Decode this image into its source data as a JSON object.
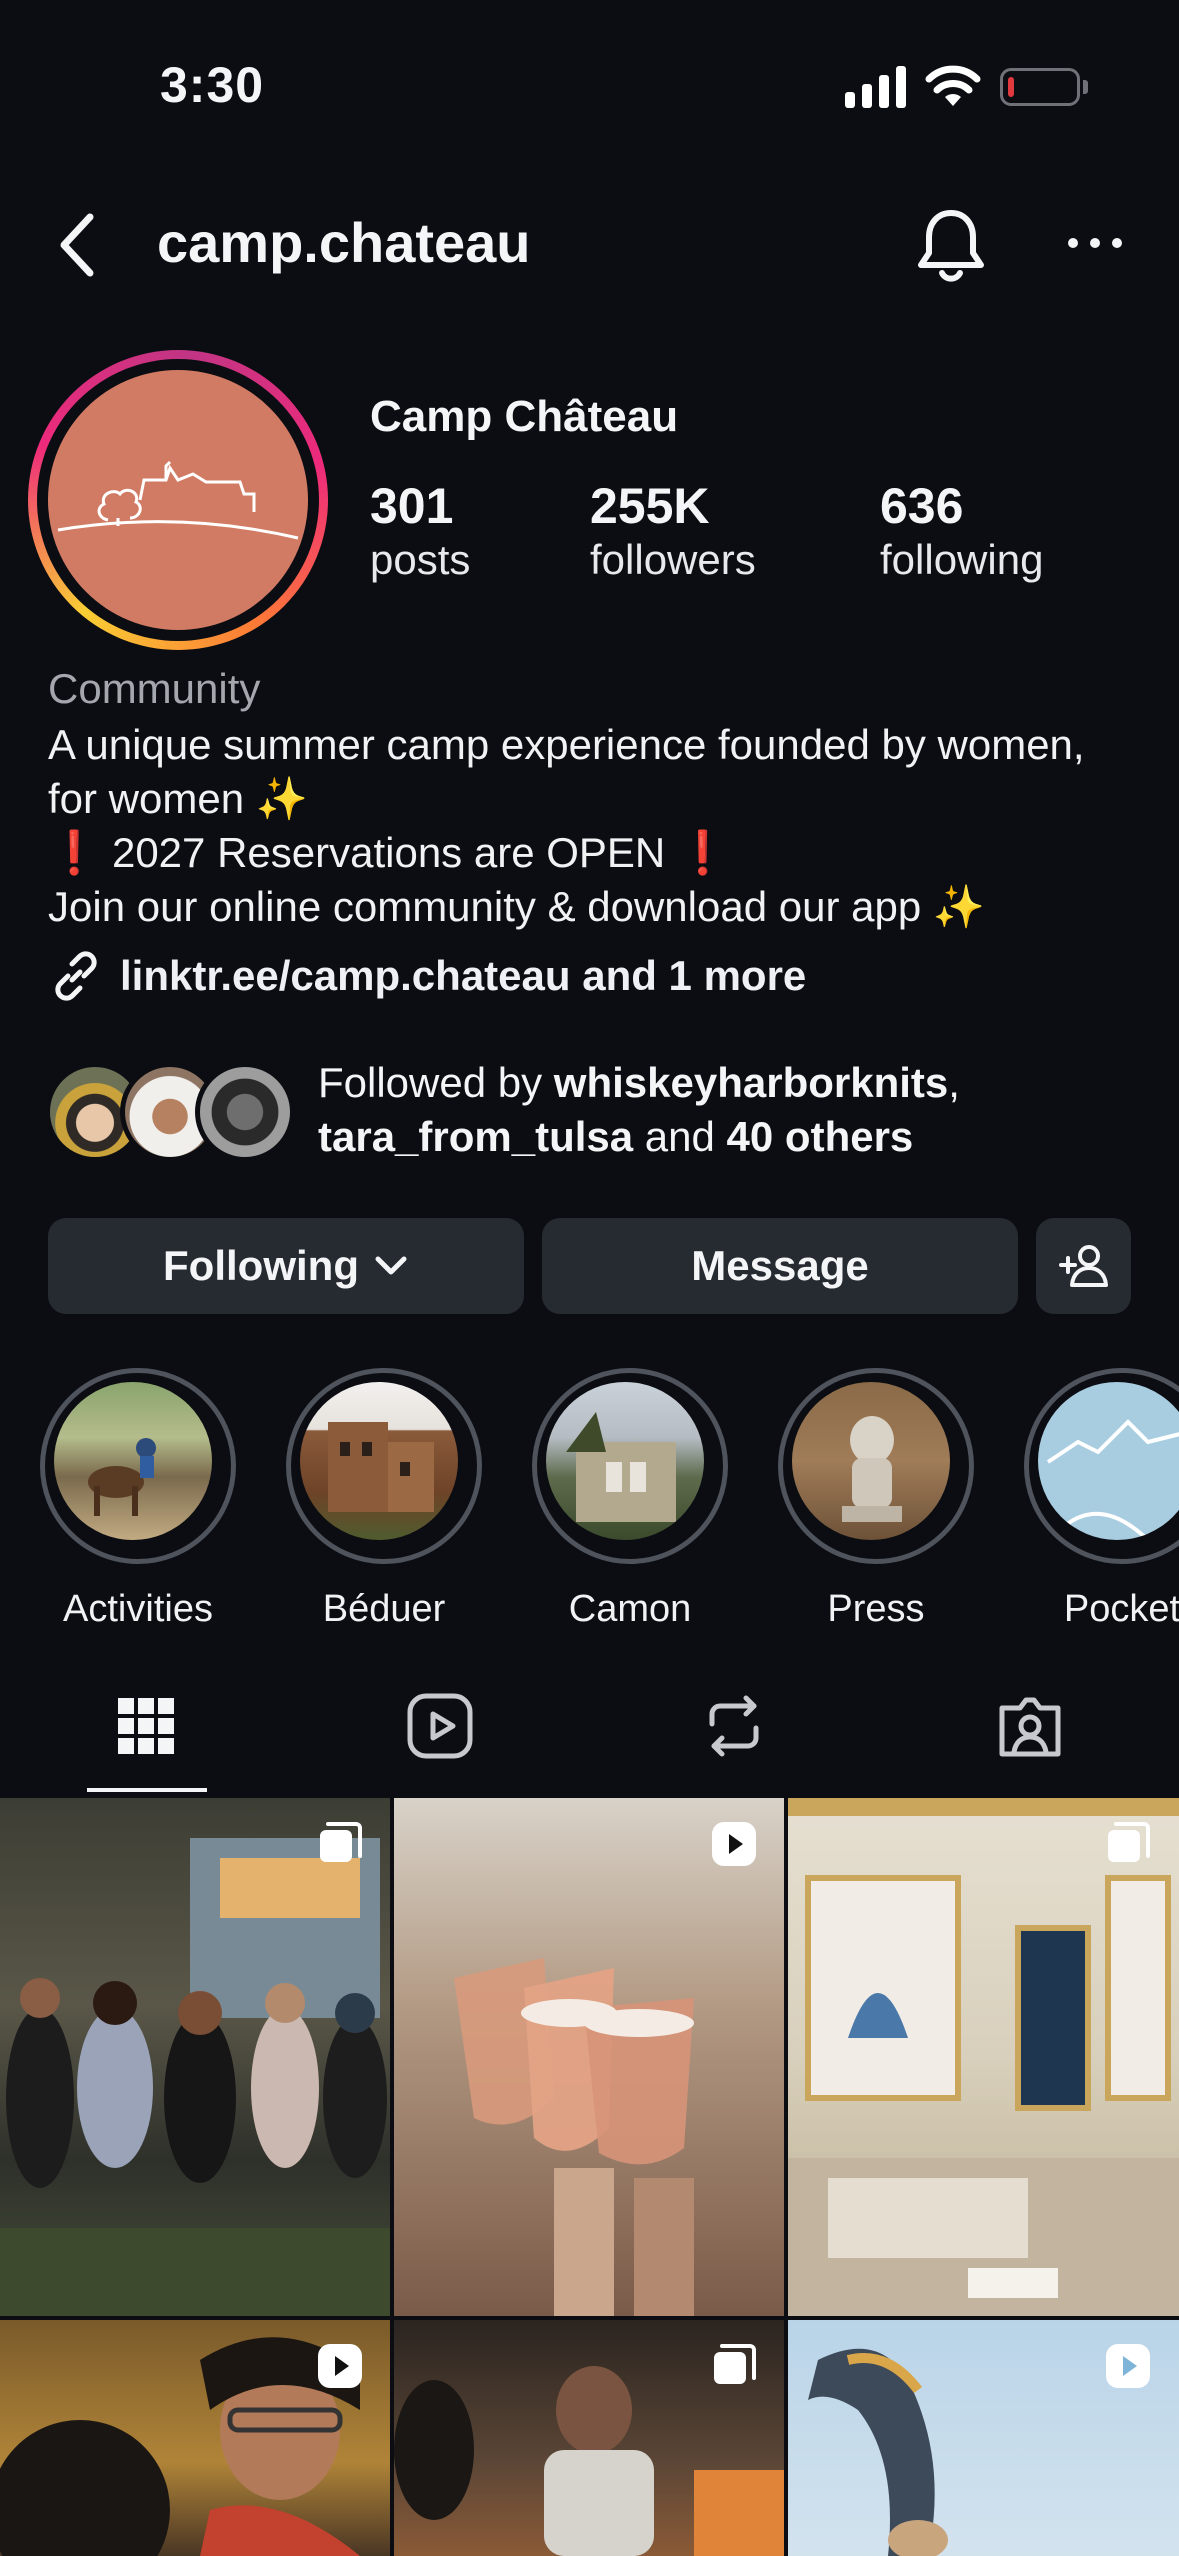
{
  "status_bar": {
    "time": "3:30",
    "battery_level": 0.1
  },
  "header": {
    "username": "camp.chateau"
  },
  "profile": {
    "display_name": "Camp Château",
    "stats": [
      {
        "value": "301",
        "label": "posts"
      },
      {
        "value": "255K",
        "label": "followers"
      },
      {
        "value": "636",
        "label": "following"
      }
    ],
    "category": "Community",
    "bio": {
      "line1": "A unique summer camp experience founded by women,",
      "line2": "for women",
      "line3": "2027 Reservations are OPEN",
      "line4": "Join our online community & download our app",
      "sparkle": "✨",
      "exclaim": "❗"
    },
    "link": "linktr.ee/camp.chateau and 1 more"
  },
  "followed_by": {
    "prefix": "Followed by",
    "user1": "whiskeyharborknits",
    "user2": "tara_from_tulsa",
    "connector": "and",
    "others": "40 others"
  },
  "actions": {
    "following_label": "Following",
    "message_label": "Message"
  },
  "highlights": [
    {
      "label": "Activities"
    },
    {
      "label": "Béduer"
    },
    {
      "label": "Camon"
    },
    {
      "label": "Press"
    },
    {
      "label": "Pocket"
    }
  ],
  "tabs": [
    {
      "icon": "grid-icon",
      "active": true
    },
    {
      "icon": "reels-icon",
      "active": false
    },
    {
      "icon": "reposts-icon",
      "active": false
    },
    {
      "icon": "tagged-icon",
      "active": false
    }
  ],
  "posts": [
    {
      "type": "carousel"
    },
    {
      "type": "reel"
    },
    {
      "type": "carousel"
    },
    {
      "type": "reel"
    },
    {
      "type": "carousel"
    },
    {
      "type": "reel"
    }
  ],
  "colors": {
    "background": "#0b0d12",
    "button": "#262a31",
    "avatar": "#d27b64",
    "story_ring": [
      "#f9ce34",
      "#ee2a7b",
      "#c13584"
    ]
  }
}
